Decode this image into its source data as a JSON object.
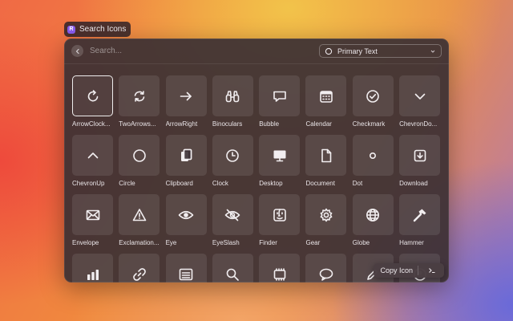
{
  "app": {
    "title": "Search Icons"
  },
  "search": {
    "placeholder": "Search..."
  },
  "filter": {
    "selected": "Primary Text"
  },
  "icons": [
    {
      "label": "ArrowClock...",
      "icon": "arrow-clockwise-icon"
    },
    {
      "label": "TwoArrows...",
      "icon": "two-arrows-circle-icon"
    },
    {
      "label": "ArrowRight",
      "icon": "arrow-right-icon"
    },
    {
      "label": "Binoculars",
      "icon": "binoculars-icon"
    },
    {
      "label": "Bubble",
      "icon": "bubble-icon"
    },
    {
      "label": "Calendar",
      "icon": "calendar-icon"
    },
    {
      "label": "Checkmark",
      "icon": "checkmark-icon"
    },
    {
      "label": "ChevronDo...",
      "icon": "chevron-down-icon"
    },
    {
      "label": "ChevronUp",
      "icon": "chevron-up-icon"
    },
    {
      "label": "Circle",
      "icon": "circle-icon"
    },
    {
      "label": "Clipboard",
      "icon": "clipboard-icon"
    },
    {
      "label": "Clock",
      "icon": "clock-icon"
    },
    {
      "label": "Desktop",
      "icon": "desktop-icon"
    },
    {
      "label": "Document",
      "icon": "document-icon"
    },
    {
      "label": "Dot",
      "icon": "dot-icon"
    },
    {
      "label": "Download",
      "icon": "download-icon"
    },
    {
      "label": "Envelope",
      "icon": "envelope-icon"
    },
    {
      "label": "Exclamation...",
      "icon": "exclamation-triangle-icon"
    },
    {
      "label": "Eye",
      "icon": "eye-icon"
    },
    {
      "label": "EyeSlash",
      "icon": "eye-slash-icon"
    },
    {
      "label": "Finder",
      "icon": "finder-icon"
    },
    {
      "label": "Gear",
      "icon": "gear-icon"
    },
    {
      "label": "Globe",
      "icon": "globe-icon"
    },
    {
      "label": "Hammer",
      "icon": "hammer-icon"
    },
    {
      "label": "",
      "icon": "bar-chart-icon"
    },
    {
      "label": "",
      "icon": "link-icon"
    },
    {
      "label": "",
      "icon": "list-icon"
    },
    {
      "label": "",
      "icon": "magnifying-glass-icon"
    },
    {
      "label": "",
      "icon": "memory-chip-icon"
    },
    {
      "label": "",
      "icon": "speech-bubble-icon"
    },
    {
      "label": "",
      "icon": "pencil-icon"
    },
    {
      "label": "",
      "icon": "person-icon"
    }
  ],
  "actions": {
    "primary": "Copy Icon"
  }
}
